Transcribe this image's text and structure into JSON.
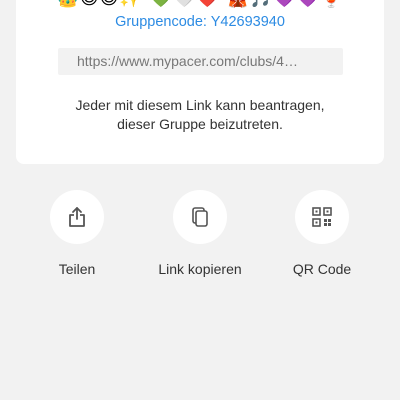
{
  "card": {
    "emoji_strip": "👑😊😊✨ 💚🤍❤️ 🎪🎵💜💜🍹",
    "group_code": "Gruppencode: Y42693940",
    "link": "https://www.mypacer.com/clubs/4…",
    "description_line1": "Jeder mit diesem Link kann beantragen,",
    "description_line2": "dieser Gruppe beizutreten."
  },
  "actions": [
    {
      "label": "Teilen",
      "icon": "share-icon"
    },
    {
      "label": "Link kopieren",
      "icon": "copy-icon"
    },
    {
      "label": "QR Code",
      "icon": "qr-code-icon"
    }
  ],
  "colors": {
    "accent": "#2c8be3",
    "background": "#f2f2f2",
    "card": "#ffffff",
    "icon": "#555555"
  }
}
